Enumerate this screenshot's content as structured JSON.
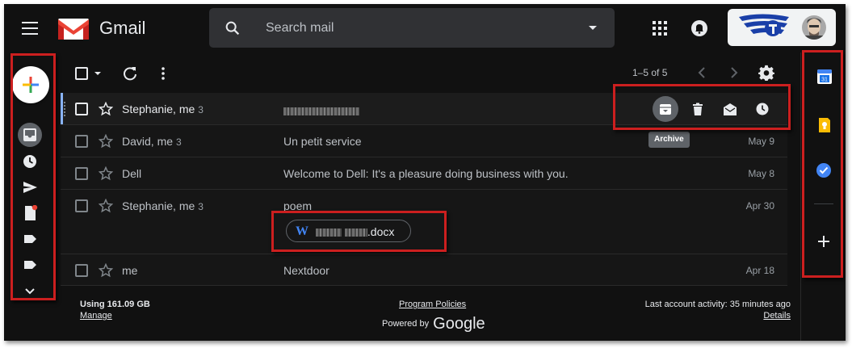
{
  "header": {
    "brand": "Gmail",
    "search_placeholder": "Search mail"
  },
  "toolbar": {
    "page_count": "1–5 of 5"
  },
  "emails": [
    {
      "sender": "Stephanie, me",
      "count": "3",
      "subject": "",
      "subject_redacted": true,
      "date": ""
    },
    {
      "sender": "David, me",
      "count": "3",
      "subject": "Un petit service",
      "date": "May 9"
    },
    {
      "sender": "Dell",
      "count": "",
      "subject": "Welcome to Dell: It's a pleasure doing business with you.",
      "date": "May 8"
    },
    {
      "sender": "Stephanie, me",
      "count": "3",
      "subject": "poem",
      "date": "Apr 30",
      "attachment_ext": ".docx"
    },
    {
      "sender": "me",
      "count": "",
      "subject": "Nextdoor",
      "date": "Apr 18"
    }
  ],
  "hover_actions": {
    "tooltip": "Archive",
    "icons": [
      "archive-icon",
      "delete-icon",
      "mark-as-read-icon",
      "snooze-icon"
    ]
  },
  "footer": {
    "storage": "Using 161.09 GB",
    "manage": "Manage",
    "program_policies": "Program Policies",
    "powered_by": "Powered by",
    "google": "Google",
    "last_activity": "Last account activity: 35 minutes ago",
    "details": "Details"
  },
  "right_rail": {
    "calendar_day": "31"
  },
  "colors": {
    "background": "#111111",
    "annotation_red": "#cc1f1f",
    "gmail_red": "#ea4335",
    "accent_blue": "#8ab4f8"
  }
}
